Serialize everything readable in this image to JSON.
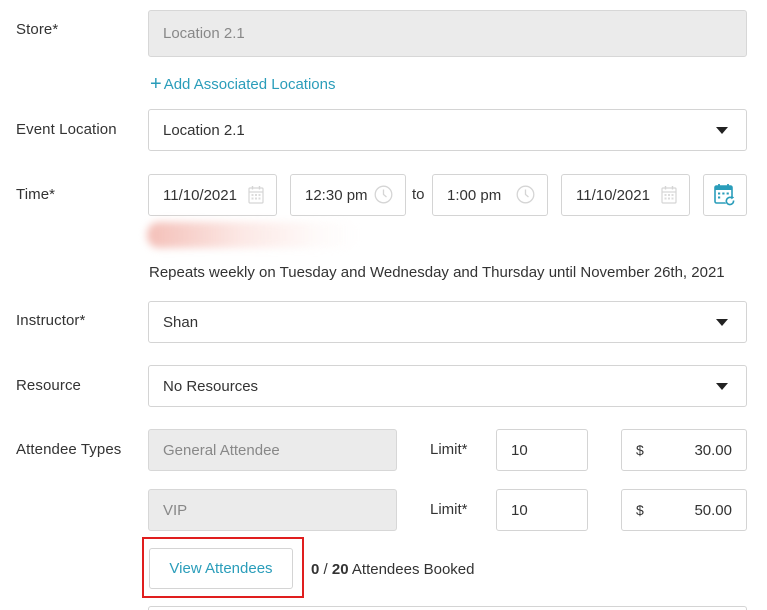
{
  "store": {
    "label": "Store*",
    "value": "Location 2.1"
  },
  "add_associated_locations": {
    "icon": "plus-icon",
    "label": "Add Associated Locations"
  },
  "event_location": {
    "label": "Event Location",
    "value": "Location 2.1"
  },
  "time": {
    "label": "Time*",
    "start_date": "11/10/2021",
    "start_time": "12:30 pm",
    "to_label": "to",
    "end_time": "1:00 pm",
    "end_date": "11/10/2021",
    "repeat_icon": "calendar-repeat-icon"
  },
  "repeat_summary": "Repeats weekly on Tuesday and Wednesday and Thursday until November 26th, 2021",
  "instructor": {
    "label": "Instructor*",
    "value": "Shan"
  },
  "resource": {
    "label": "Resource",
    "value": "No Resources"
  },
  "attendee_types": {
    "label": "Attendee Types",
    "limit_label": "Limit*",
    "currency": "$",
    "rows": [
      {
        "name": "General Attendee",
        "limit": "10",
        "price": "30.00"
      },
      {
        "name": "VIP",
        "limit": "10",
        "price": "50.00"
      }
    ]
  },
  "view_attendees": {
    "label": "View Attendees"
  },
  "booked": {
    "count": "0",
    "separator": "/",
    "total": "20",
    "suffix": "Attendees Booked"
  },
  "colors": {
    "accent": "#2a9dba",
    "highlight": "#e01e1e",
    "disabled_bg": "#ebebeb"
  }
}
